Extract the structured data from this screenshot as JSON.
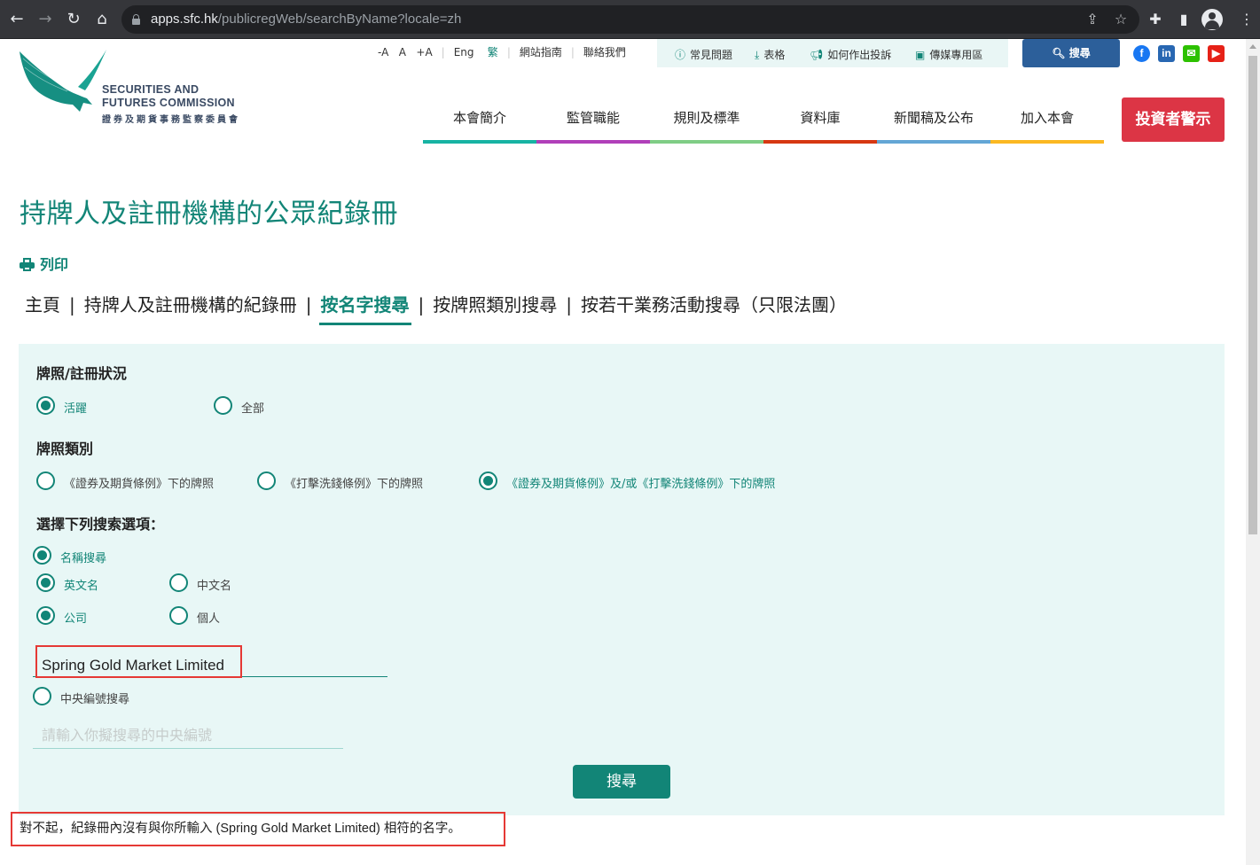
{
  "browser": {
    "url_host": "apps.sfc.hk",
    "url_path": "/publicregWeb/searchByName?locale=zh"
  },
  "header": {
    "logo_en_line1": "SECURITIES AND",
    "logo_en_line2": "FUTURES COMMISSION",
    "logo_cn": "證券及期貨事務監察委員會",
    "font_size": {
      "decrease": "-A",
      "normal": "A",
      "increase": "+A"
    },
    "lang": {
      "en": "Eng",
      "zh": "繁"
    },
    "sitemap": "網站指南",
    "contact": "聯絡我們",
    "quick_links": [
      {
        "icon": "question-circle-icon",
        "label": "常見問題"
      },
      {
        "icon": "download-icon",
        "label": "表格"
      },
      {
        "icon": "megaphone-icon",
        "label": "如何作出投訴"
      },
      {
        "icon": "image-icon",
        "label": "傳媒專用區"
      }
    ],
    "search_label": "搜尋",
    "social": [
      "facebook",
      "linkedin",
      "wechat",
      "youtube"
    ],
    "main_nav": [
      {
        "label": "本會簡介",
        "color": "#17b3a3"
      },
      {
        "label": "監管職能",
        "color": "#b03fb9"
      },
      {
        "label": "規則及標準",
        "color": "#7fcd85"
      },
      {
        "label": "資料庫",
        "color": "#d63812"
      },
      {
        "label": "新聞稿及公布",
        "color": "#63a6d5"
      },
      {
        "label": "加入本會",
        "color": "#fbb822"
      }
    ],
    "investor_alert": "投資者警示"
  },
  "page": {
    "title": "持牌人及註冊機構的公眾紀錄冊",
    "print_label": "列印",
    "breadcrumb": [
      {
        "label": "主頁",
        "current": false
      },
      {
        "label": "持牌人及註冊機構的紀錄冊",
        "current": false
      },
      {
        "label": "按名字搜尋",
        "current": true
      },
      {
        "label": "按牌照類別搜尋",
        "current": false
      },
      {
        "label": "按若干業務活動搜尋（只限法團）",
        "current": false
      }
    ],
    "breadcrumb_sep": "|"
  },
  "form": {
    "status_label": "牌照/註冊狀況",
    "status_options": [
      {
        "label": "活躍",
        "checked": true
      },
      {
        "label": "全部",
        "checked": false
      }
    ],
    "licence_label": "牌照類別",
    "licence_options": [
      {
        "label": "《證券及期貨條例》下的牌照",
        "checked": false
      },
      {
        "label": "《打擊洗錢條例》下的牌照",
        "checked": false
      },
      {
        "label": "《證券及期貨條例》及/或《打擊洗錢條例》下的牌照",
        "checked": true
      }
    ],
    "search_options_label": "選擇下列搜索選項：",
    "name_search": {
      "label": "名稱搜尋",
      "checked": true
    },
    "name_lang": [
      {
        "label": "英文名",
        "checked": true
      },
      {
        "label": "中文名",
        "checked": false
      }
    ],
    "entity_type": [
      {
        "label": "公司",
        "checked": true
      },
      {
        "label": "個人",
        "checked": false
      }
    ],
    "name_value": "Spring Gold Market Limited",
    "ce_search": {
      "label": "中央編號搜尋",
      "checked": false
    },
    "ce_placeholder": "請輸入你擬搜尋的中央編號",
    "ce_value": "",
    "submit_label": "搜尋"
  },
  "result_message": "對不起，紀錄冊內沒有與你所輸入 (Spring Gold Market Limited) 相符的名字。"
}
